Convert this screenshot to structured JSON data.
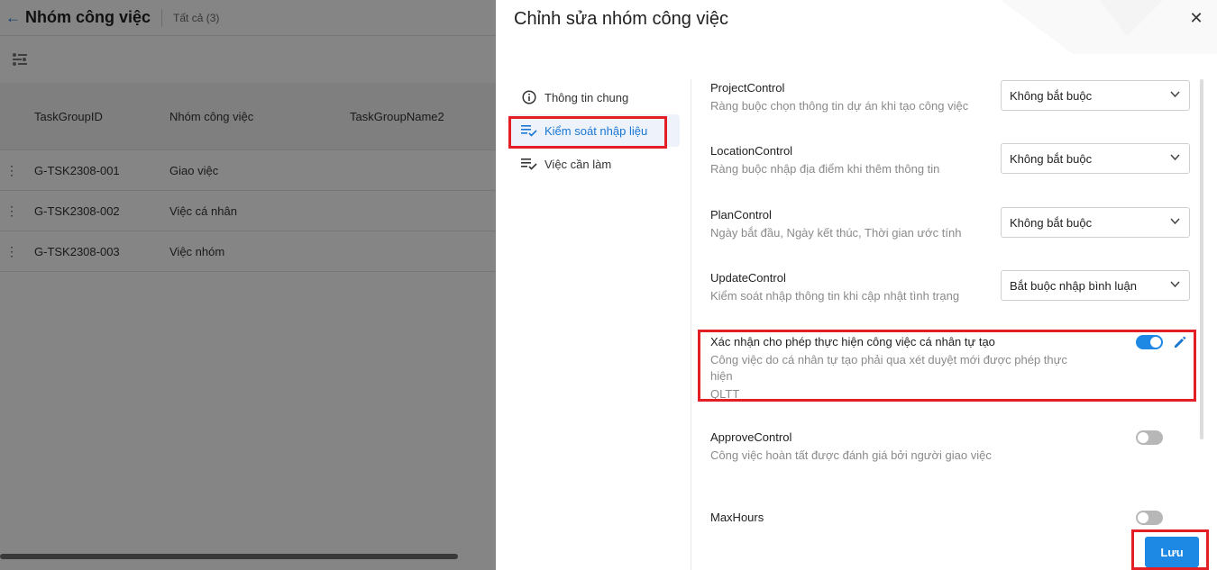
{
  "background": {
    "title": "Nhóm công việc",
    "count_label": "Tất cả (3)",
    "table": {
      "columns": [
        "TaskGroupID",
        "Nhóm công việc",
        "TaskGroupName2"
      ],
      "rows": [
        {
          "id": "G-TSK2308-001",
          "name": "Giao việc"
        },
        {
          "id": "G-TSK2308-002",
          "name": "Việc cá nhân"
        },
        {
          "id": "G-TSK2308-003",
          "name": "Việc nhóm"
        }
      ]
    }
  },
  "drawer": {
    "title": "Chỉnh sửa nhóm công việc",
    "close_icon": "close-icon",
    "nav": [
      {
        "label": "Thông tin chung",
        "icon": "info-icon"
      },
      {
        "label": "Kiểm soát nhập liệu",
        "icon": "list-check-icon",
        "active": true
      },
      {
        "label": "Việc cần làm",
        "icon": "list-check-icon"
      }
    ],
    "settings": {
      "project_control": {
        "name": "ProjectControl",
        "desc": "Ràng buộc chọn thông tin dự án khi tạo công việc",
        "value": "Không bắt buộc"
      },
      "location_control": {
        "name": "LocationControl",
        "desc": "Ràng buộc nhập địa điểm khi thêm thông tin",
        "value": "Không bắt buộc"
      },
      "plan_control": {
        "name": "PlanControl",
        "desc": "Ngày bắt đầu, Ngày kết thúc, Thời gian ước tính",
        "value": "Không bắt buộc"
      },
      "update_control": {
        "name": "UpdateControl",
        "desc": "Kiểm soát nhập thông tin khi cập nhật tình trạng",
        "value": "Bắt buộc nhập bình luận"
      },
      "self_task": {
        "name": "Xác nhận cho phép thực hiện công việc cá nhân tự tạo",
        "desc": "Công việc do cá nhân tự tạo phải qua xét duyệt mới được phép thực hiện",
        "note": "QLTT",
        "enabled": true
      },
      "approve_control": {
        "name": "ApproveControl",
        "desc": "Công việc hoàn tất được đánh giá bởi người giao việc",
        "enabled": false
      },
      "max_hours": {
        "name": "MaxHours",
        "enabled": false
      }
    },
    "save_label": "Lưu"
  },
  "colors": {
    "accent": "#1e88e5",
    "highlight": "#e41e25"
  }
}
